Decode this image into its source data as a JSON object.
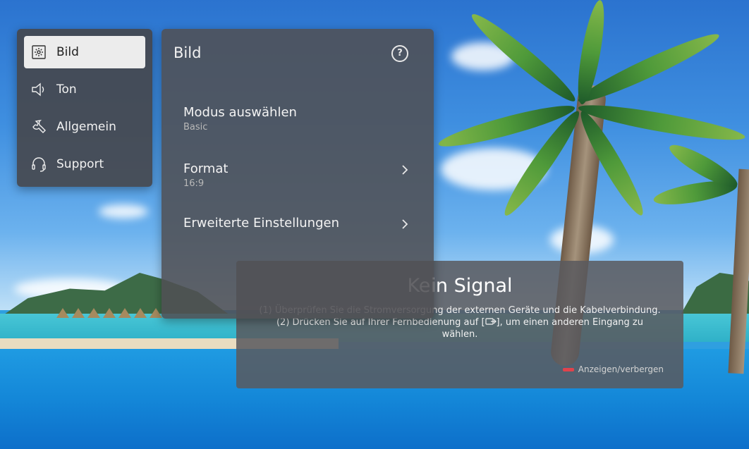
{
  "sidebar": {
    "items": [
      {
        "label": "Bild",
        "icon": "picture-settings-icon",
        "active": true
      },
      {
        "label": "Ton",
        "icon": "speaker-icon",
        "active": false
      },
      {
        "label": "Allgemein",
        "icon": "wrench-icon",
        "active": false
      },
      {
        "label": "Support",
        "icon": "headset-icon",
        "active": false
      }
    ]
  },
  "panel": {
    "title": "Bild",
    "help_icon": "question-mark-icon",
    "help_glyph": "?",
    "rows": [
      {
        "label": "Modus auswählen",
        "value": "Basic"
      },
      {
        "label": "Format",
        "value": "16:9"
      },
      {
        "label": "Erweiterte Einstellungen",
        "value": ""
      }
    ]
  },
  "dialog": {
    "title": "Kein Signal",
    "line1": "(1) Überprüfen Sie die Stromversorgung der externen Geräte und die Kabelverbindung.",
    "line2_before": "(2) Drücken Sie auf Ihrer Fernbedienung auf [",
    "line2_after": "], um einen anderen Eingang zu wählen.",
    "footer_label": "Anzeigen/verbergen",
    "footer_key_color": "#e0434c"
  },
  "colors": {
    "active_item_bg": "#ececec",
    "panel_bg": "#505054"
  }
}
